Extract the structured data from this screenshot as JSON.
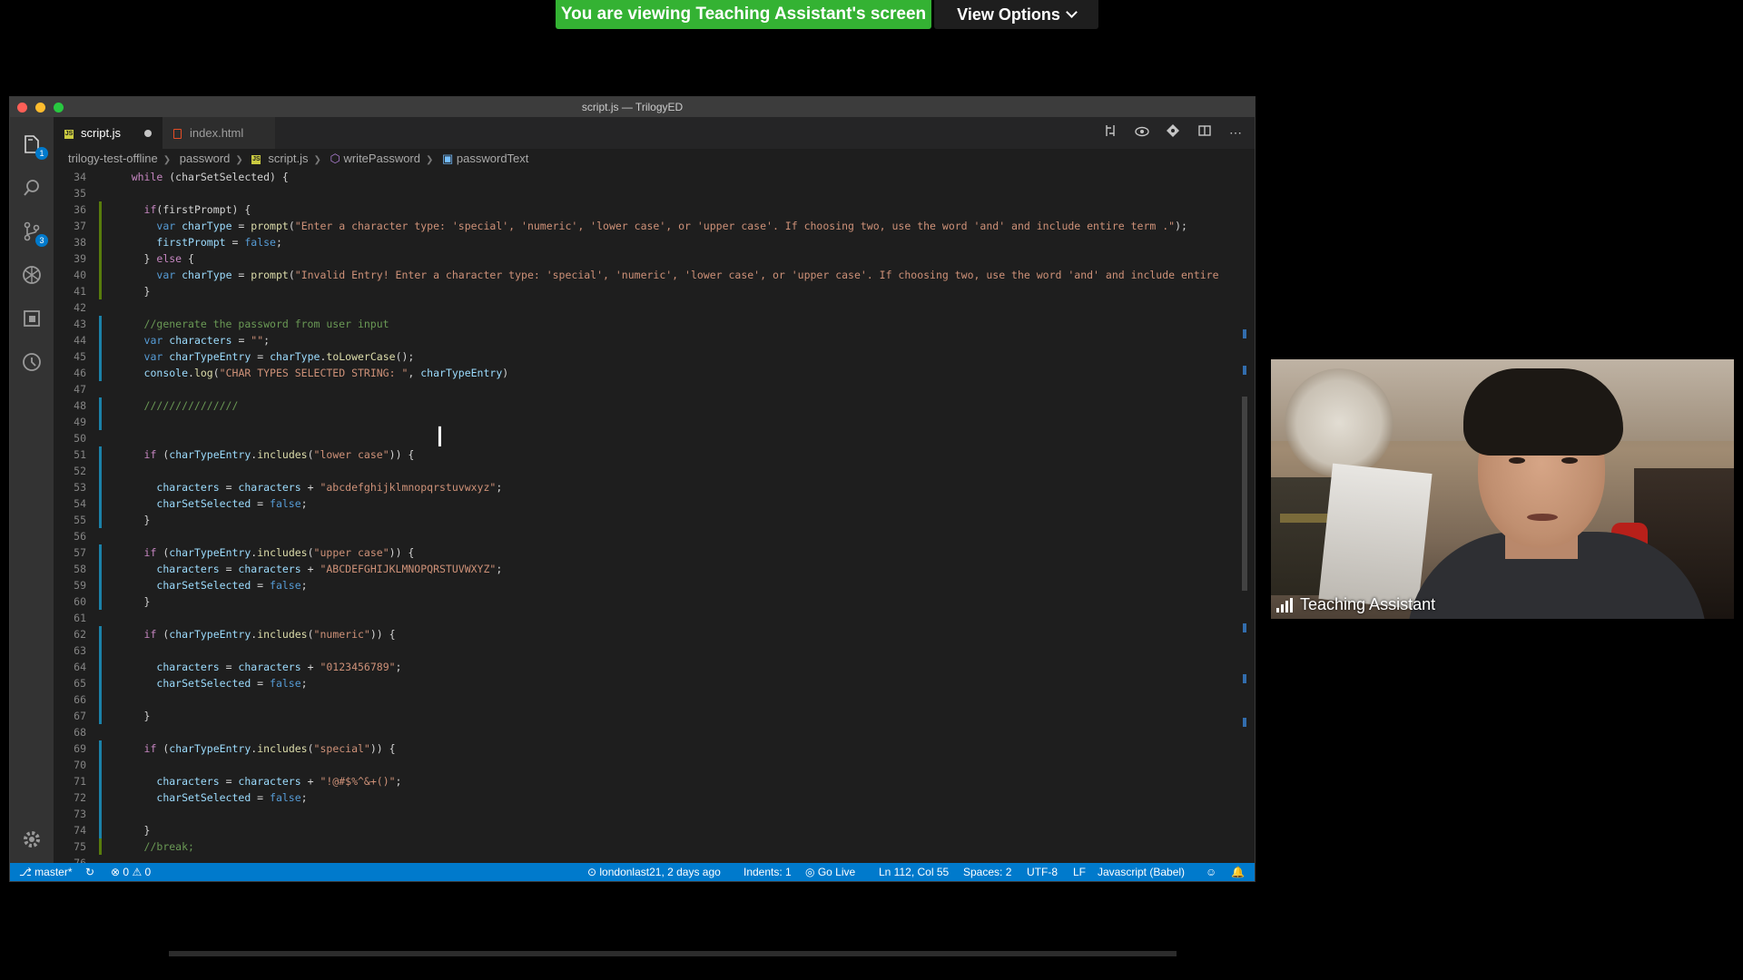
{
  "zoom": {
    "banner": "You are viewing Teaching Assistant's screen",
    "view_options": "View Options",
    "participant_name": "Teaching Assistant"
  },
  "window": {
    "title": "script.js — TrilogyED"
  },
  "tabs": [
    {
      "label": "script.js",
      "icon": "js",
      "active": true,
      "dirty": true
    },
    {
      "label": "index.html",
      "icon": "html",
      "active": false
    }
  ],
  "editor_actions": [
    "open-changes-icon",
    "toggle-preview-icon",
    "git-compare-icon",
    "split-editor-icon",
    "more-actions-icon"
  ],
  "breadcrumb": [
    "trilogy-test-offline",
    "password",
    "script.js",
    "writePassword",
    "passwordText"
  ],
  "activity_bar": {
    "explorer_badge": "1",
    "scm_badge": "3"
  },
  "code_lines": [
    {
      "n": "34",
      "tokens": [
        [
          "plain",
          "    "
        ],
        [
          "control",
          "while"
        ],
        [
          "plain",
          " (charSetSelected) {"
        ]
      ]
    },
    {
      "n": "35",
      "tokens": []
    },
    {
      "n": "36",
      "tokens": [
        [
          "plain",
          "      "
        ],
        [
          "control",
          "if"
        ],
        [
          "plain",
          "(firstPrompt) {"
        ]
      ]
    },
    {
      "n": "37",
      "tokens": [
        [
          "plain",
          "        "
        ],
        [
          "keyword",
          "var"
        ],
        [
          "plain",
          " "
        ],
        [
          "variable",
          "charType"
        ],
        [
          "plain",
          " = "
        ],
        [
          "function",
          "prompt"
        ],
        [
          "plain",
          "("
        ],
        [
          "string",
          "\"Enter a character type: 'special', 'numeric', 'lower case', or 'upper case'. If choosing two, use the word 'and' and include entire term .\""
        ],
        [
          "plain",
          ");"
        ]
      ]
    },
    {
      "n": "38",
      "tokens": [
        [
          "plain",
          "        "
        ],
        [
          "variable",
          "firstPrompt"
        ],
        [
          "plain",
          " = "
        ],
        [
          "keyword",
          "false"
        ],
        [
          "plain",
          ";"
        ]
      ]
    },
    {
      "n": "39",
      "tokens": [
        [
          "plain",
          "      } "
        ],
        [
          "control",
          "else"
        ],
        [
          "plain",
          " {"
        ]
      ]
    },
    {
      "n": "40",
      "tokens": [
        [
          "plain",
          "        "
        ],
        [
          "keyword",
          "var"
        ],
        [
          "plain",
          " "
        ],
        [
          "variable",
          "charType"
        ],
        [
          "plain",
          " = "
        ],
        [
          "function",
          "prompt"
        ],
        [
          "plain",
          "("
        ],
        [
          "string",
          "\"Invalid Entry! Enter a character type: 'special', 'numeric', 'lower case', or 'upper case'. If choosing two, use the word 'and' and include entire"
        ]
      ]
    },
    {
      "n": "41",
      "tokens": [
        [
          "plain",
          "      }"
        ]
      ]
    },
    {
      "n": "42",
      "tokens": []
    },
    {
      "n": "43",
      "tokens": [
        [
          "plain",
          "      "
        ],
        [
          "comment",
          "//generate the password from user input"
        ]
      ]
    },
    {
      "n": "44",
      "tokens": [
        [
          "plain",
          "      "
        ],
        [
          "keyword",
          "var"
        ],
        [
          "plain",
          " "
        ],
        [
          "variable",
          "characters"
        ],
        [
          "plain",
          " = "
        ],
        [
          "string",
          "\"\""
        ],
        [
          "plain",
          ";"
        ]
      ]
    },
    {
      "n": "45",
      "tokens": [
        [
          "plain",
          "      "
        ],
        [
          "keyword",
          "var"
        ],
        [
          "plain",
          " "
        ],
        [
          "variable",
          "charTypeEntry"
        ],
        [
          "plain",
          " = "
        ],
        [
          "variable",
          "charType"
        ],
        [
          "plain",
          "."
        ],
        [
          "function",
          "toLowerCase"
        ],
        [
          "plain",
          "();"
        ]
      ]
    },
    {
      "n": "46",
      "tokens": [
        [
          "plain",
          "      "
        ],
        [
          "variable",
          "console"
        ],
        [
          "plain",
          "."
        ],
        [
          "function",
          "log"
        ],
        [
          "plain",
          "("
        ],
        [
          "string",
          "\"CHAR TYPES SELECTED STRING: \""
        ],
        [
          "plain",
          ", "
        ],
        [
          "variable",
          "charTypeEntry"
        ],
        [
          "plain",
          ")"
        ]
      ]
    },
    {
      "n": "47",
      "tokens": []
    },
    {
      "n": "48",
      "tokens": [
        [
          "plain",
          "      "
        ],
        [
          "comment",
          "///////////////"
        ]
      ]
    },
    {
      "n": "49",
      "tokens": []
    },
    {
      "n": "50",
      "tokens": []
    },
    {
      "n": "51",
      "tokens": [
        [
          "plain",
          "      "
        ],
        [
          "control",
          "if"
        ],
        [
          "plain",
          " ("
        ],
        [
          "variable",
          "charTypeEntry"
        ],
        [
          "plain",
          "."
        ],
        [
          "function",
          "includes"
        ],
        [
          "plain",
          "("
        ],
        [
          "string",
          "\"lower case\""
        ],
        [
          "plain",
          ")) {"
        ]
      ]
    },
    {
      "n": "52",
      "tokens": []
    },
    {
      "n": "53",
      "tokens": [
        [
          "plain",
          "        "
        ],
        [
          "variable",
          "characters"
        ],
        [
          "plain",
          " = "
        ],
        [
          "variable",
          "characters"
        ],
        [
          "plain",
          " + "
        ],
        [
          "string",
          "\"abcdefghijklmnopqrstuvwxyz\""
        ],
        [
          "plain",
          ";"
        ]
      ]
    },
    {
      "n": "54",
      "tokens": [
        [
          "plain",
          "        "
        ],
        [
          "variable",
          "charSetSelected"
        ],
        [
          "plain",
          " = "
        ],
        [
          "keyword",
          "false"
        ],
        [
          "plain",
          ";"
        ]
      ]
    },
    {
      "n": "55",
      "tokens": [
        [
          "plain",
          "      }"
        ]
      ]
    },
    {
      "n": "56",
      "tokens": []
    },
    {
      "n": "57",
      "tokens": [
        [
          "plain",
          "      "
        ],
        [
          "control",
          "if"
        ],
        [
          "plain",
          " ("
        ],
        [
          "variable",
          "charTypeEntry"
        ],
        [
          "plain",
          "."
        ],
        [
          "function",
          "includes"
        ],
        [
          "plain",
          "("
        ],
        [
          "string",
          "\"upper case\""
        ],
        [
          "plain",
          ")) {"
        ]
      ]
    },
    {
      "n": "58",
      "tokens": [
        [
          "plain",
          "        "
        ],
        [
          "variable",
          "characters"
        ],
        [
          "plain",
          " = "
        ],
        [
          "variable",
          "characters"
        ],
        [
          "plain",
          " + "
        ],
        [
          "string",
          "\"ABCDEFGHIJKLMNOPQRSTUVWXYZ\""
        ],
        [
          "plain",
          ";"
        ]
      ]
    },
    {
      "n": "59",
      "tokens": [
        [
          "plain",
          "        "
        ],
        [
          "variable",
          "charSetSelected"
        ],
        [
          "plain",
          " = "
        ],
        [
          "keyword",
          "false"
        ],
        [
          "plain",
          ";"
        ]
      ]
    },
    {
      "n": "60",
      "tokens": [
        [
          "plain",
          "      }"
        ]
      ]
    },
    {
      "n": "61",
      "tokens": []
    },
    {
      "n": "62",
      "tokens": [
        [
          "plain",
          "      "
        ],
        [
          "control",
          "if"
        ],
        [
          "plain",
          " ("
        ],
        [
          "variable",
          "charTypeEntry"
        ],
        [
          "plain",
          "."
        ],
        [
          "function",
          "includes"
        ],
        [
          "plain",
          "("
        ],
        [
          "string",
          "\"numeric\""
        ],
        [
          "plain",
          ")) {"
        ]
      ]
    },
    {
      "n": "63",
      "tokens": []
    },
    {
      "n": "64",
      "tokens": [
        [
          "plain",
          "        "
        ],
        [
          "variable",
          "characters"
        ],
        [
          "plain",
          " = "
        ],
        [
          "variable",
          "characters"
        ],
        [
          "plain",
          " + "
        ],
        [
          "string",
          "\"0123456789\""
        ],
        [
          "plain",
          ";"
        ]
      ]
    },
    {
      "n": "65",
      "tokens": [
        [
          "plain",
          "        "
        ],
        [
          "variable",
          "charSetSelected"
        ],
        [
          "plain",
          " = "
        ],
        [
          "keyword",
          "false"
        ],
        [
          "plain",
          ";"
        ]
      ]
    },
    {
      "n": "66",
      "tokens": []
    },
    {
      "n": "67",
      "tokens": [
        [
          "plain",
          "      }"
        ]
      ]
    },
    {
      "n": "68",
      "tokens": []
    },
    {
      "n": "69",
      "tokens": [
        [
          "plain",
          "      "
        ],
        [
          "control",
          "if"
        ],
        [
          "plain",
          " ("
        ],
        [
          "variable",
          "charTypeEntry"
        ],
        [
          "plain",
          "."
        ],
        [
          "function",
          "includes"
        ],
        [
          "plain",
          "("
        ],
        [
          "string",
          "\"special\""
        ],
        [
          "plain",
          ")) {"
        ]
      ]
    },
    {
      "n": "70",
      "tokens": []
    },
    {
      "n": "71",
      "tokens": [
        [
          "plain",
          "        "
        ],
        [
          "variable",
          "characters"
        ],
        [
          "plain",
          " = "
        ],
        [
          "variable",
          "characters"
        ],
        [
          "plain",
          " + "
        ],
        [
          "string",
          "\"!@#$%^&+()\""
        ],
        [
          "plain",
          ";"
        ]
      ]
    },
    {
      "n": "72",
      "tokens": [
        [
          "plain",
          "        "
        ],
        [
          "variable",
          "charSetSelected"
        ],
        [
          "plain",
          " = "
        ],
        [
          "keyword",
          "false"
        ],
        [
          "plain",
          ";"
        ]
      ]
    },
    {
      "n": "73",
      "tokens": []
    },
    {
      "n": "74",
      "tokens": [
        [
          "plain",
          "      }"
        ]
      ]
    },
    {
      "n": "75",
      "tokens": [
        [
          "plain",
          "      "
        ],
        [
          "comment",
          "//break;"
        ]
      ]
    },
    {
      "n": "76",
      "tokens": []
    }
  ],
  "gutter": {
    "36": "add",
    "37": "add",
    "38": "add",
    "39": "add",
    "40": "add",
    "41": "add",
    "43": "mod",
    "44": "mod",
    "45": "mod",
    "46": "mod",
    "48": "mod",
    "49": "mod",
    "51": "mod",
    "52": "mod",
    "53": "mod",
    "54": "mod",
    "55": "mod",
    "57": "mod",
    "58": "mod",
    "59": "mod",
    "60": "mod",
    "62": "mod",
    "63": "mod",
    "64": "mod",
    "65": "mod",
    "66": "mod",
    "67": "mod",
    "69": "mod",
    "70": "mod",
    "71": "mod",
    "72": "mod",
    "73": "mod",
    "74": "mod",
    "75": "add"
  },
  "status": {
    "branch": "master*",
    "errors": "0",
    "warnings": "0",
    "blame": "londonlast21, 2 days ago",
    "indents": "Indents: 1",
    "go_live": "Go Live",
    "position": "Ln 112, Col 55",
    "spaces": "Spaces: 2",
    "encoding": "UTF-8",
    "eol": "LF",
    "language": "Javascript (Babel)"
  },
  "colors": {
    "zoom_green": "#34b233",
    "status_blue": "#007acc",
    "editor_bg": "#1e1e1e"
  }
}
